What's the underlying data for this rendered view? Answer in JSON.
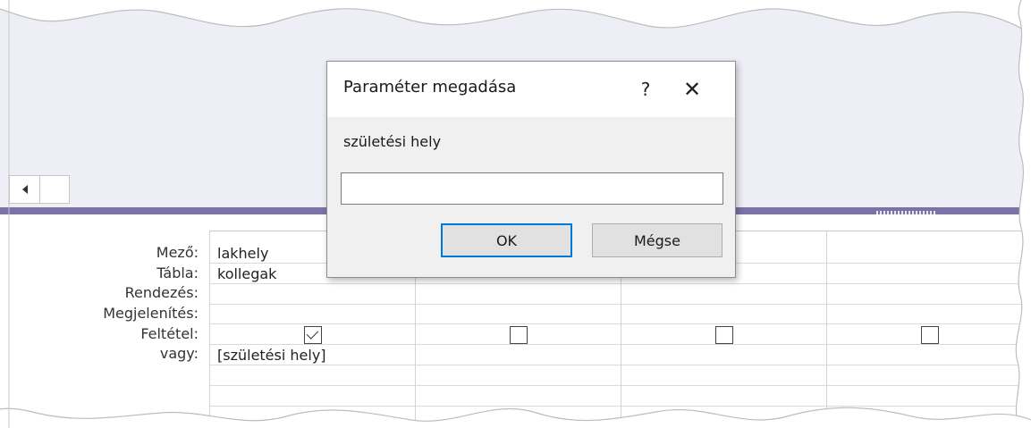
{
  "query_grid": {
    "row_labels": [
      "Mező:",
      "Tábla:",
      "Rendezés:",
      "Megjelenítés:",
      "Feltétel:",
      "vagy:"
    ],
    "columns": [
      {
        "field": "lakhely",
        "table": "kollegak",
        "sort": "",
        "show": true,
        "criteria": "[születési hely]",
        "or": ""
      },
      {
        "field": "",
        "table": "",
        "sort": "",
        "show": false,
        "criteria": "",
        "or": ""
      },
      {
        "field": "",
        "table": "",
        "sort": "",
        "show": false,
        "criteria": "",
        "or": ""
      },
      {
        "field": "",
        "table": "",
        "sort": "",
        "show": false,
        "criteria": "",
        "or": ""
      }
    ]
  },
  "dialog": {
    "title": "Paraméter megadása",
    "help_label": "?",
    "close_label": "✕",
    "prompt": "születési hely",
    "input_value": "",
    "ok_label": "OK",
    "cancel_label": "Mégse"
  },
  "colors": {
    "splitter": "#7b73a6",
    "top_pane": "#eeeef7",
    "ok_focus": "#0078d7"
  },
  "icons": {
    "scroll_left": "triangle-left-icon",
    "checkbox": "checkmark-icon"
  }
}
